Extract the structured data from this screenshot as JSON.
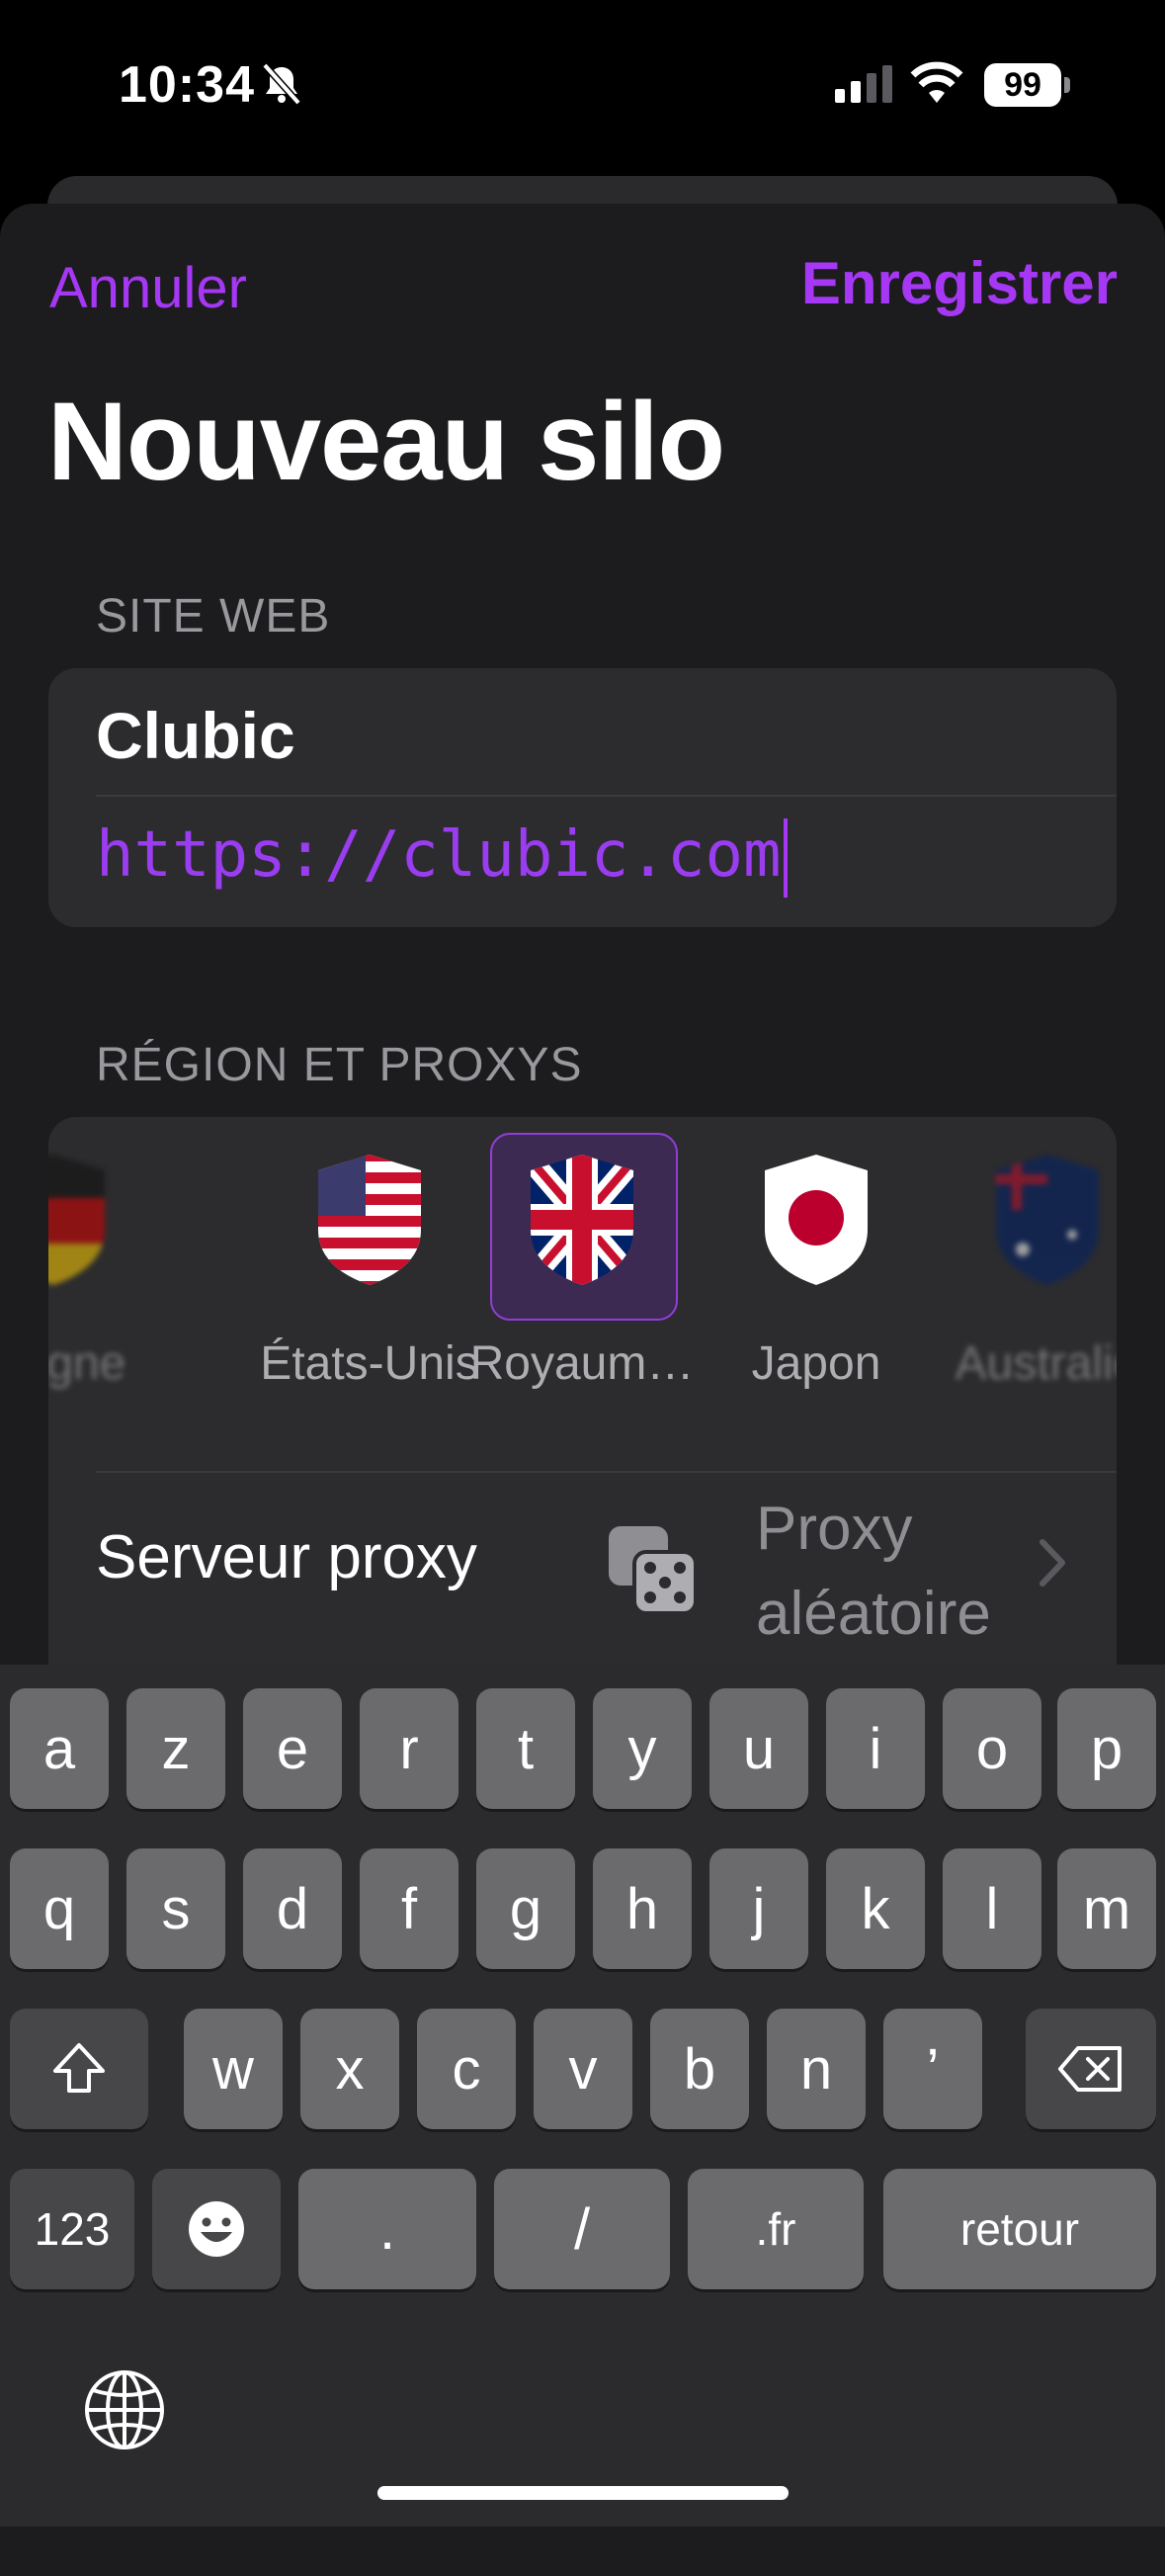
{
  "status_bar": {
    "time": "10:34",
    "battery": "99"
  },
  "nav": {
    "cancel": "Annuler",
    "save": "Enregistrer"
  },
  "title": "Nouveau silo",
  "website_section": {
    "label": "SITE WEB",
    "name": "Clubic",
    "url": "https://clubic.com"
  },
  "region_section": {
    "label": "RÉGION ET PROXYS",
    "regions": [
      {
        "label": "magne",
        "flag": "germany-flag-icon"
      },
      {
        "label": "États-Unis",
        "flag": "usa-flag-icon"
      },
      {
        "label": "Royaum…",
        "flag": "uk-flag-icon",
        "selected": true
      },
      {
        "label": "Japon",
        "flag": "japan-flag-icon"
      },
      {
        "label": "Australie",
        "flag": "australia-flag-icon"
      }
    ],
    "proxy_row": {
      "label": "Serveur proxy",
      "value_line1": "Proxy",
      "value_line2": "aléatoire",
      "icon": "dice-icon"
    }
  },
  "keyboard": {
    "row1": [
      "a",
      "z",
      "e",
      "r",
      "t",
      "y",
      "u",
      "i",
      "o",
      "p"
    ],
    "row2": [
      "q",
      "s",
      "d",
      "f",
      "g",
      "h",
      "j",
      "k",
      "l",
      "m"
    ],
    "row3": [
      "w",
      "x",
      "c",
      "v",
      "b",
      "n",
      "’"
    ],
    "row4": {
      "numbers": "123",
      "dot": ".",
      "slash": "/",
      "tld": ".fr",
      "return": "retour"
    }
  },
  "colors": {
    "accent": "#a638f5",
    "background": "#1c1c1e",
    "card": "#2c2c2e"
  }
}
